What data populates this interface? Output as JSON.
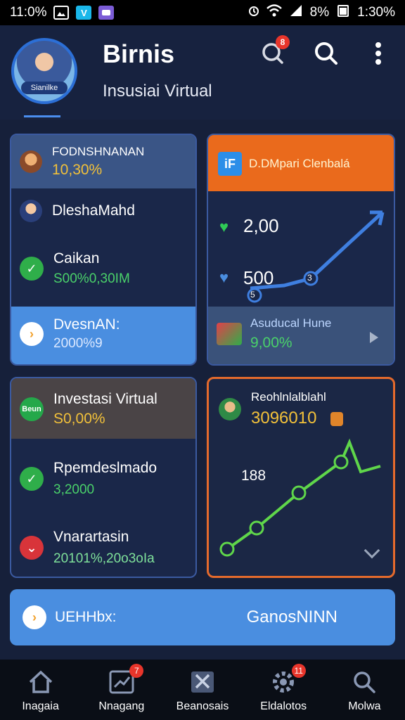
{
  "status_bar": {
    "time_left": "11:0%",
    "battery": "8%",
    "time_right": "1:30%"
  },
  "header": {
    "title": "Birnis",
    "subtitle": "Insusiai Virtual",
    "avatar_tag": "Sianilke",
    "notification_count": "8"
  },
  "card_a": {
    "header_label": "FODNSHNANAN",
    "header_value": "10,30%",
    "row1_label": "DleshaMahd",
    "row2_label": "Caikan",
    "row2_value": "S00%0,30IM",
    "row3_label": "DvesnAN:",
    "row3_value": "2000%9"
  },
  "card_b": {
    "logo_text": "iF",
    "header_label": "D.DMpari Clenbalá",
    "value_top": "2,00",
    "value_mid": "500",
    "point1": "5",
    "point2": "3",
    "row_label": "Asuducal Hune",
    "row_value": "9,00%"
  },
  "card_c": {
    "badge_text": "Beun",
    "header_label": "Investasi Virtual",
    "header_value": "S0,00%",
    "row1_label": "Rpemdeslmado",
    "row1_value": "3,2000",
    "row2_label": "Vnarartasin",
    "row2_value": "20101%,20o3oIa"
  },
  "card_d": {
    "header_label": "Reohlnlalblahl",
    "header_value": "3096010",
    "chart_label": "188"
  },
  "wide_button": {
    "label": "UEHHbx:",
    "action": "GanosNINN"
  },
  "bottom_nav": [
    {
      "label": "Inagaia",
      "badge": ""
    },
    {
      "label": "Nnagang",
      "badge": "7"
    },
    {
      "label": "Beanosais",
      "badge": ""
    },
    {
      "label": "Eldalotos",
      "badge": "11"
    },
    {
      "label": "Molwa",
      "badge": ""
    }
  ],
  "colors": {
    "background": "#16203a",
    "accent_blue": "#4a8ee0",
    "accent_orange": "#ea6a1c",
    "positive_green": "#4ad16a",
    "value_yellow": "#f2c13a"
  }
}
